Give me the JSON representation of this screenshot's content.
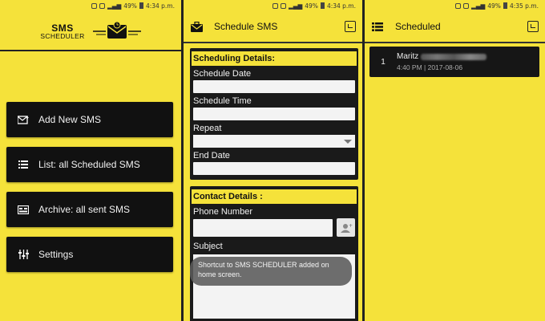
{
  "status": {
    "battery": "49%",
    "time1": "4:34 p.m.",
    "time2": "4:34 p.m.",
    "time3": "4:35 p.m."
  },
  "screen1": {
    "logo_line1": "SMS",
    "logo_line2": "SCHEDULER",
    "menu": [
      {
        "label": "Add New SMS",
        "icon": "envelope-add-icon"
      },
      {
        "label": "List: all Scheduled SMS",
        "icon": "list-icon"
      },
      {
        "label": "Archive: all sent SMS",
        "icon": "archive-icon"
      },
      {
        "label": "Settings",
        "icon": "sliders-icon"
      }
    ]
  },
  "screen2": {
    "title": "Schedule SMS",
    "scheduling_title": "Scheduling Details:",
    "schedule_date_label": "Schedule Date",
    "schedule_time_label": "Schedule Time",
    "repeat_label": "Repeat",
    "end_date_label": "End Date",
    "contact_title": "Contact Details :",
    "phone_label": "Phone Number",
    "subject_label": "Subject",
    "toast": "Shortcut to SMS SCHEDULER added on home screen."
  },
  "screen3": {
    "title": "Scheduled",
    "items": [
      {
        "index": "1",
        "name": "Maritz",
        "meta": "4:40 PM | 2017-08-06"
      }
    ]
  },
  "colors": {
    "accent": "#f5e23a",
    "dark": "#111111"
  }
}
